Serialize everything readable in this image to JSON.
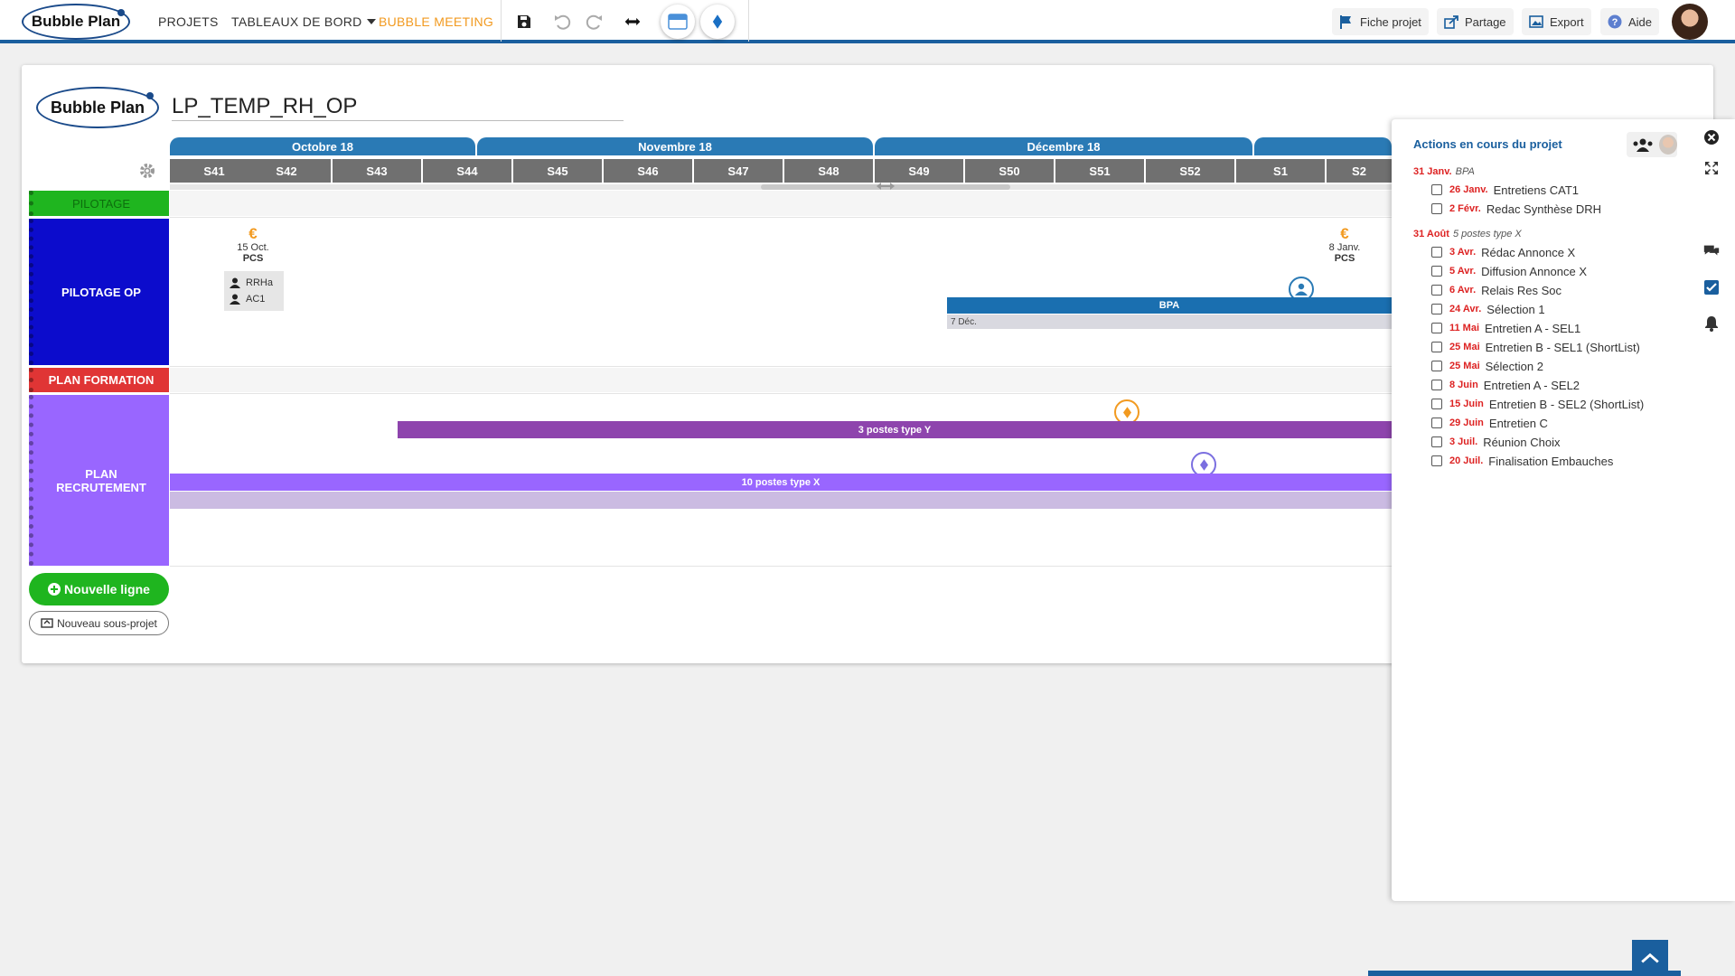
{
  "app": {
    "logo": "Bubble Plan"
  },
  "nav": {
    "projets": "PROJETS",
    "tableaux": "TABLEAUX DE BORD",
    "meeting": "BUBBLE MEETING"
  },
  "toolbar": {
    "icons": [
      "save-icon",
      "undo-icon",
      "redo-icon",
      "expand-horizontal-icon",
      "calendar-icon",
      "milestone-icon"
    ]
  },
  "actions": {
    "fiche": "Fiche projet",
    "partage": "Partage",
    "export": "Export",
    "aide": "Aide"
  },
  "project": {
    "title": "LP_TEMP_RH_OP"
  },
  "timeline": {
    "months": [
      "Octobre 18",
      "Novembre 18",
      "Décembre 18",
      ""
    ],
    "weeks": [
      "S41",
      "S42",
      "S43",
      "S44",
      "S45",
      "S46",
      "S47",
      "S48",
      "S49",
      "S50",
      "S51",
      "S52",
      "S1",
      "S2"
    ]
  },
  "rows": {
    "pilotage": "PILOTAGE",
    "pilotage_op": "PILOTAGE OP",
    "plan_formation": "PLAN FORMATION",
    "plan_recrutement": "PLAN RECRUTEMENT"
  },
  "milestones": {
    "m1": {
      "date": "15 Oct.",
      "label": "PCS"
    },
    "m2": {
      "date": "8 Janv.",
      "label": "PCS"
    },
    "persons": [
      "RRHa",
      "AC1"
    ]
  },
  "bars": {
    "bpa": {
      "label": "BPA",
      "sub": "7 Déc."
    },
    "y": {
      "label": "3 postes type Y"
    },
    "x": {
      "label": "10 postes type X"
    }
  },
  "buttons": {
    "new_line": "Nouvelle ligne",
    "new_sub": "Nouveau sous-projet"
  },
  "panel": {
    "title": "Actions en cours du projet",
    "groups": [
      {
        "date": "31 Janv.",
        "name": "BPA",
        "items": [
          {
            "date": "26 Janv.",
            "label": "Entretiens CAT1"
          },
          {
            "date": "2 Févr.",
            "label": "Redac Synthèse DRH"
          }
        ]
      },
      {
        "date": "31 Août",
        "name": "5 postes type X",
        "items": [
          {
            "date": "3 Avr.",
            "label": "Rédac Annonce X"
          },
          {
            "date": "5 Avr.",
            "label": "Diffusion Annonce X"
          },
          {
            "date": "6 Avr.",
            "label": "Relais Res Soc"
          },
          {
            "date": "24 Avr.",
            "label": "Sélection 1"
          },
          {
            "date": "11 Mai",
            "label": "Entretien A - SEL1"
          },
          {
            "date": "25 Mai",
            "label": "Entretien B - SEL1 (ShortList)"
          },
          {
            "date": "25 Mai",
            "label": "Sélection 2"
          },
          {
            "date": "8 Juin",
            "label": "Entretien A - SEL2"
          },
          {
            "date": "15 Juin",
            "label": "Entretien B - SEL2 (ShortList)"
          },
          {
            "date": "29 Juin",
            "label": "Entretien C"
          },
          {
            "date": "3 Juil.",
            "label": "Réunion Choix"
          },
          {
            "date": "20 Juil.",
            "label": "Finalisation Embauches"
          }
        ]
      }
    ]
  },
  "colors": {
    "brand": "#1a5f9e",
    "accent": "#f29a20",
    "pilotage": "#1fb51f",
    "pilotage_op": "#0c0ccc",
    "formation": "#e03535",
    "recrutement": "#9966ff",
    "bar_y": "#8e44ad",
    "bar_x": "#9966ff"
  }
}
